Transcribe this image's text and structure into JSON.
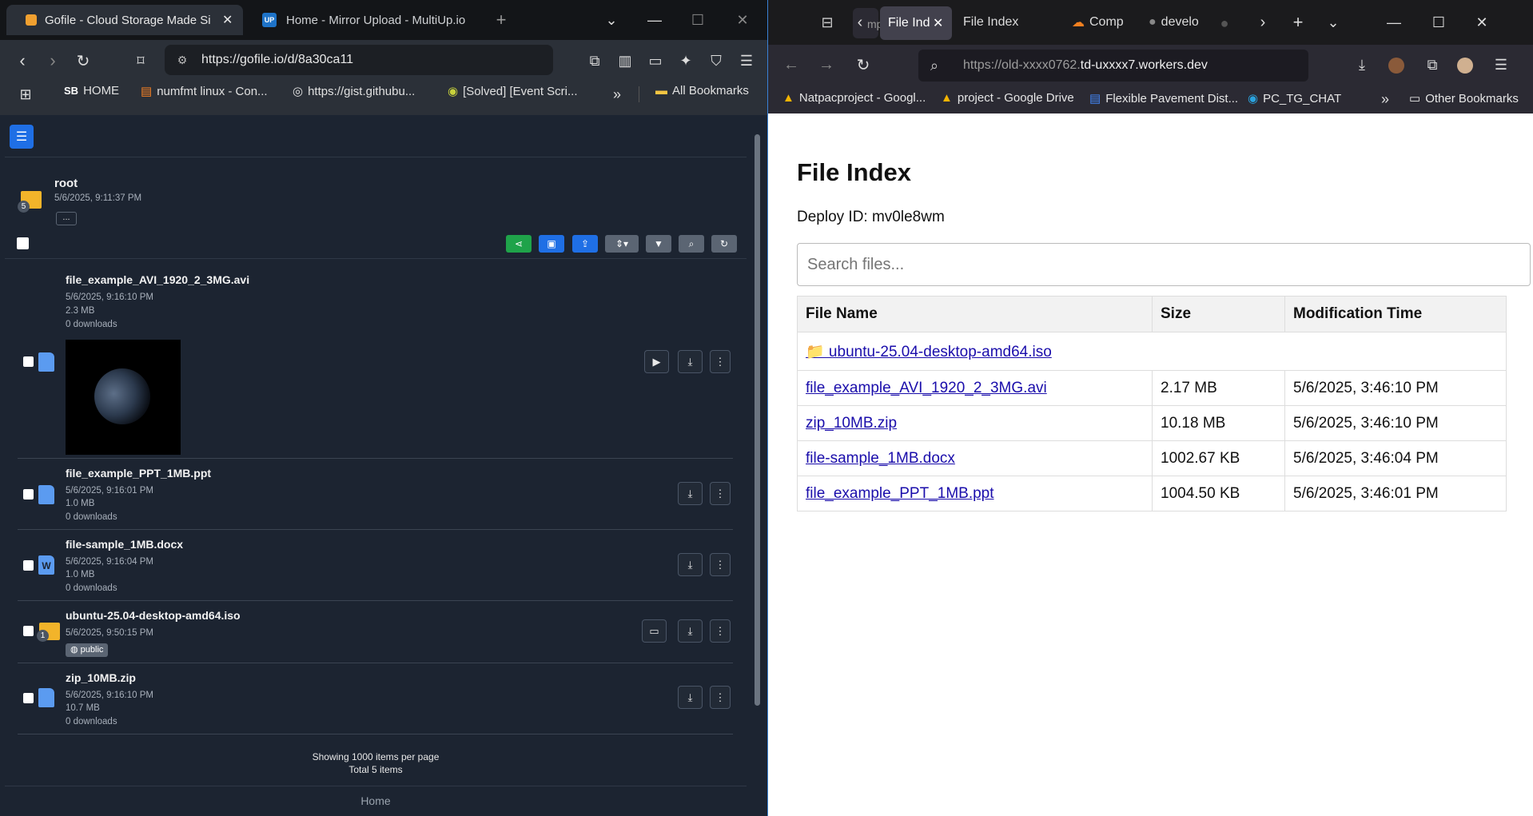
{
  "left": {
    "tabs": [
      {
        "title": "Gofile - Cloud Storage Made Si"
      },
      {
        "title": "Home - Mirror Upload - MultiUp.io"
      }
    ],
    "url": "https://gofile.io/d/8a30ca11",
    "bookmarks": [
      {
        "label": "HOME",
        "badge": "SB"
      },
      {
        "label": "numfmt linux - Con..."
      },
      {
        "label": "https://gist.githubu..."
      },
      {
        "label": "[Solved] [Event Scri..."
      }
    ],
    "all_bookmarks": "All Bookmarks",
    "folder": {
      "name": "root",
      "date": "5/6/2025, 9:11:37 PM",
      "count": "5",
      "more": "..."
    },
    "files": [
      {
        "name": "file_example_AVI_1920_2_3MG.avi",
        "date": "5/6/2025, 9:16:10 PM",
        "size": "2.3 MB",
        "downloads": "0 downloads"
      },
      {
        "name": "file_example_PPT_1MB.ppt",
        "date": "5/6/2025, 9:16:01 PM",
        "size": "1.0 MB",
        "downloads": "0 downloads"
      },
      {
        "name": "file-sample_1MB.docx",
        "date": "5/6/2025, 9:16:04 PM",
        "size": "1.0 MB",
        "downloads": "0 downloads"
      },
      {
        "name": "ubuntu-25.04-desktop-amd64.iso",
        "date": "5/6/2025, 9:50:15 PM",
        "badge": "public",
        "count": "1"
      },
      {
        "name": "zip_10MB.zip",
        "date": "5/6/2025, 9:16:10 PM",
        "size": "10.7 MB",
        "downloads": "0 downloads"
      }
    ],
    "footer": {
      "per_page": "Showing 1000 items per page",
      "total": "Total 5 items",
      "home": "Home"
    }
  },
  "right": {
    "tabs": [
      {
        "title": "mp"
      },
      {
        "title": "File Ind"
      },
      {
        "title": "File Index"
      },
      {
        "title": "Comp"
      },
      {
        "title": "develo"
      }
    ],
    "url_prefix": "https://old-xxxx0762.",
    "url_domain": "td-uxxxx7.workers.dev",
    "bookmarks": [
      {
        "label": "Natpacproject - Googl..."
      },
      {
        "label": "project - Google Drive"
      },
      {
        "label": "Flexible Pavement Dist..."
      },
      {
        "label": "PC_TG_CHAT"
      }
    ],
    "other_bookmarks": "Other Bookmarks",
    "page": {
      "title": "File Index",
      "deploy": "Deploy ID: mv0le8wm",
      "search_placeholder": "Search files...",
      "headers": [
        "File Name",
        "Size",
        "Modification Time"
      ],
      "folder": "📁 ubuntu-25.04-desktop-amd64.iso",
      "rows": [
        {
          "name": "file_example_AVI_1920_2_3MG.avi",
          "size": "2.17 MB",
          "time": "5/6/2025, 3:46:10 PM"
        },
        {
          "name": "zip_10MB.zip",
          "size": "10.18 MB",
          "time": "5/6/2025, 3:46:10 PM"
        },
        {
          "name": "file-sample_1MB.docx",
          "size": "1002.67 KB",
          "time": "5/6/2025, 3:46:04 PM"
        },
        {
          "name": "file_example_PPT_1MB.ppt",
          "size": "1004.50 KB",
          "time": "5/6/2025, 3:46:01 PM"
        }
      ]
    }
  },
  "colors": {
    "accent_blue": "#1f6fe5",
    "share_green": "#1fa34a",
    "dark_bg": "#1c2431",
    "link": "#1a0dab"
  }
}
